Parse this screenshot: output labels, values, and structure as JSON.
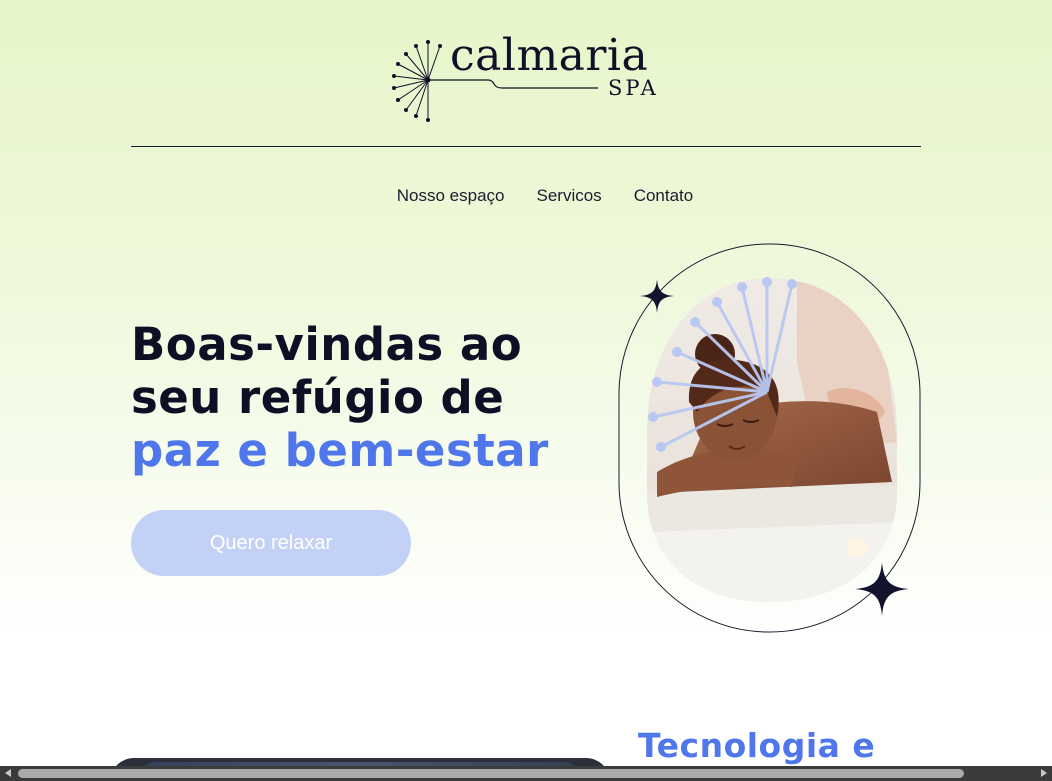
{
  "header": {
    "logo_word": "calmaria",
    "logo_sub": "SPA"
  },
  "nav": {
    "items": [
      {
        "label": "Nosso espaço"
      },
      {
        "label": "Servicos"
      },
      {
        "label": "Contato"
      }
    ]
  },
  "hero": {
    "title_line1": "Boas-vindas ao",
    "title_line2": "seu refúgio de",
    "title_line3": "paz e bem-estar",
    "cta_label": "Quero relaxar",
    "image_alt": "Mulher recebendo massagem"
  },
  "next_section": {
    "title": "Tecnologia e"
  },
  "colors": {
    "accent": "#4f76ea",
    "cta_bg": "#c4d1f6",
    "text_dark": "#0f0e24",
    "bg_top": "#e6f5c9"
  },
  "icons": [
    "dandelion-logo-icon",
    "sparkle-icon"
  ]
}
